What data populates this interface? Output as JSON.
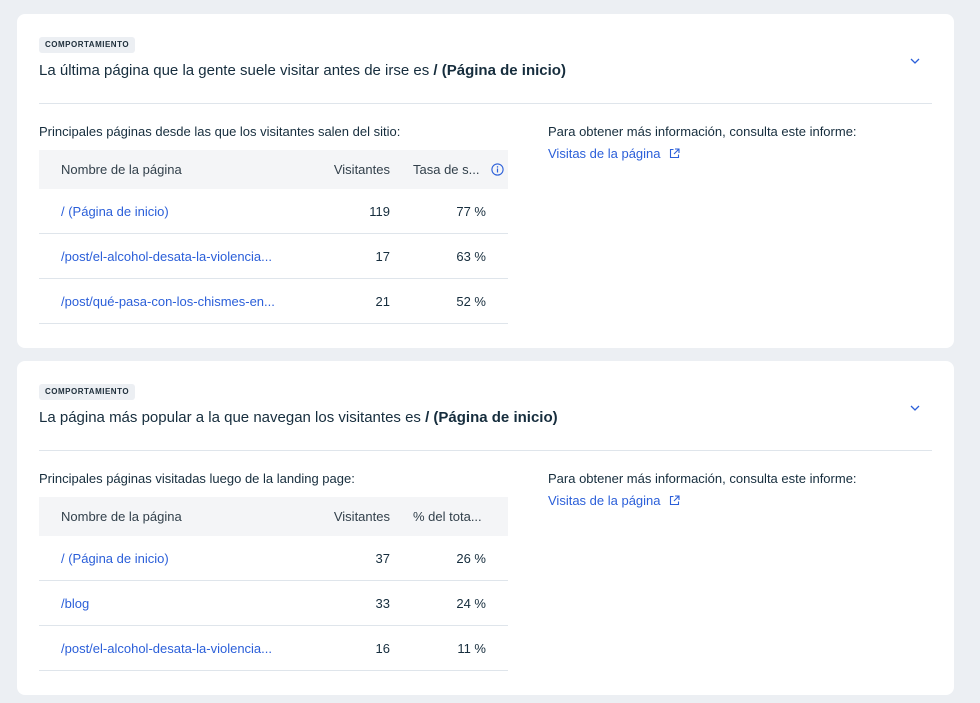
{
  "cards": [
    {
      "badge": "COMPORTAMIENTO",
      "headline_prefix": "La última página que la gente suele visitar antes de irse es ",
      "headline_bold": "/ (Página de inicio)",
      "subtitle": "Principales páginas desde las que los visitantes salen del sitio:",
      "table": {
        "headers": [
          "Nombre de la página",
          "Visitantes",
          "Tasa de s..."
        ],
        "rows": [
          {
            "name": "/ (Página de inicio)",
            "visitors": "119",
            "rate": "77 %"
          },
          {
            "name": "/post/el-alcohol-desata-la-violencia...",
            "visitors": "17",
            "rate": "63 %"
          },
          {
            "name": "/post/qué-pasa-con-los-chismes-en...",
            "visitors": "21",
            "rate": "52 %"
          }
        ]
      },
      "side_text": "Para obtener más información, consulta este informe:",
      "side_link": "Visitas de la página"
    },
    {
      "badge": "COMPORTAMIENTO",
      "headline_prefix": "La página más popular a la que navegan los visitantes es ",
      "headline_bold": "/ (Página de inicio)",
      "subtitle": "Principales páginas visitadas luego de la landing page:",
      "table": {
        "headers": [
          "Nombre de la página",
          "Visitantes",
          "% del tota..."
        ],
        "rows": [
          {
            "name": "/ (Página de inicio)",
            "visitors": "37",
            "rate": "26 %"
          },
          {
            "name": "/blog",
            "visitors": "33",
            "rate": "24 %"
          },
          {
            "name": "/post/el-alcohol-desata-la-violencia...",
            "visitors": "16",
            "rate": "11 %"
          }
        ]
      },
      "side_text": "Para obtener más información, consulta este informe:",
      "side_link": "Visitas de la página"
    }
  ],
  "icons": {
    "collapse": "chevron-down-icon",
    "info": "info-icon",
    "external": "external-link-icon"
  },
  "colors": {
    "link": "#2b5fd9",
    "background": "#eceff3"
  }
}
